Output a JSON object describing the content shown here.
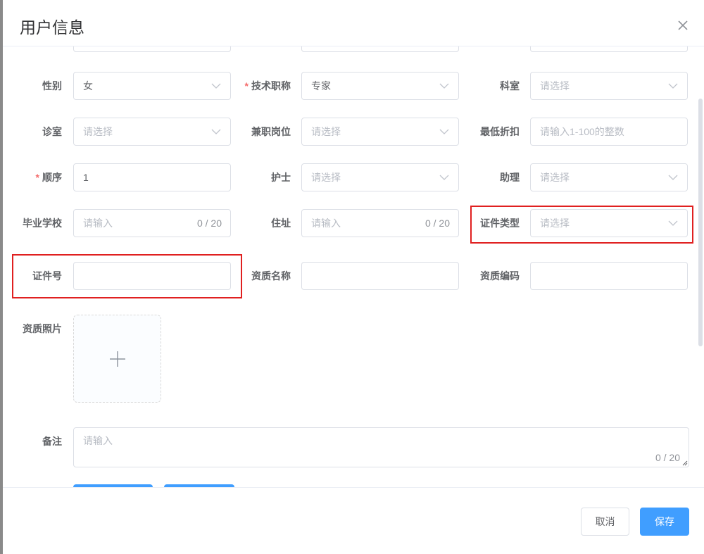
{
  "dialog": {
    "title": "用户信息"
  },
  "form": {
    "gender": {
      "label": "性别",
      "value": "女"
    },
    "tech_title": {
      "label": "技术职称",
      "value": "专家",
      "required_mark": "*"
    },
    "department": {
      "label": "科室",
      "placeholder": "请选择"
    },
    "clinic": {
      "label": "诊室",
      "placeholder": "请选择"
    },
    "part_time_post": {
      "label": "兼职岗位",
      "placeholder": "请选择"
    },
    "min_discount": {
      "label": "最低折扣",
      "placeholder": "请输入1-100的整数"
    },
    "order": {
      "label": "顺序",
      "value": "1",
      "required_mark": "*"
    },
    "nurse": {
      "label": "护士",
      "placeholder": "请选择"
    },
    "assistant": {
      "label": "助理",
      "placeholder": "请选择"
    },
    "school": {
      "label": "毕业学校",
      "placeholder": "请输入",
      "count": "0 / 20"
    },
    "address": {
      "label": "住址",
      "placeholder": "请输入",
      "count": "0 / 20"
    },
    "id_type": {
      "label": "证件类型",
      "placeholder": "请选择"
    },
    "id_number": {
      "label": "证件号",
      "value": ""
    },
    "qualification_name": {
      "label": "资质名称",
      "value": ""
    },
    "qualification_code": {
      "label": "资质编码",
      "value": ""
    },
    "qualification_photo": {
      "label": "资质照片"
    },
    "remark": {
      "label": "备注",
      "placeholder": "请输入",
      "count": "0 / 20"
    }
  },
  "footer": {
    "cancel_label": "取消",
    "save_label": "保存"
  },
  "colors": {
    "primary": "#409eff",
    "required": "#f56c6c",
    "highlight": "#e02020"
  }
}
